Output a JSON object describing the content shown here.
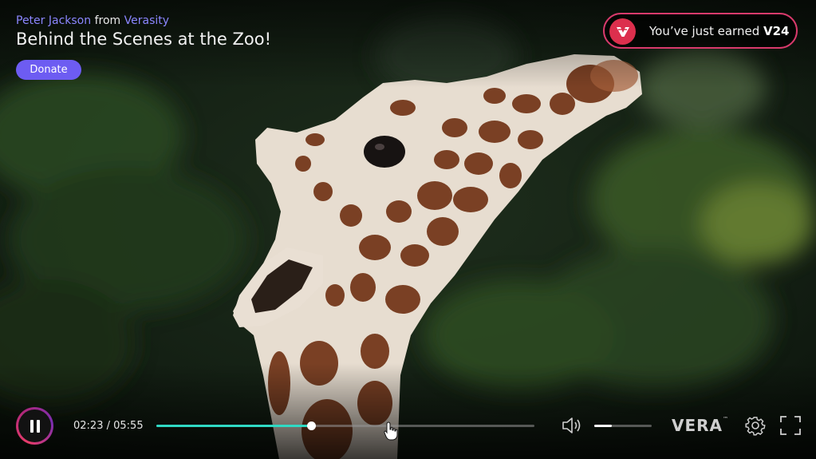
{
  "header": {
    "author": "Peter Jackson",
    "from_word": "from",
    "channel": "Verasity",
    "title": "Behind the Scenes at the Zoo!",
    "donate_label": "Donate"
  },
  "reward": {
    "message": "You’ve just earned",
    "currency_symbol": "V",
    "amount": "24",
    "badge_icon": "verasity-v-icon",
    "border_color": "#d83a6c",
    "badge_color": "#dc2f4d"
  },
  "player": {
    "state_icon": "pause-icon",
    "current_time": "02:23",
    "duration": "05:55",
    "time_separator": " / ",
    "progress_fraction": 0.41,
    "progress_color": "#2fd9c4",
    "volume_fraction": 0.3,
    "logo_text": "VERA",
    "logo_mark": "™",
    "icons": [
      "volume-icon",
      "settings-gear-icon",
      "fullscreen-icon"
    ]
  },
  "colors": {
    "link": "#8b86ff",
    "donate": "#6d5cf2"
  }
}
